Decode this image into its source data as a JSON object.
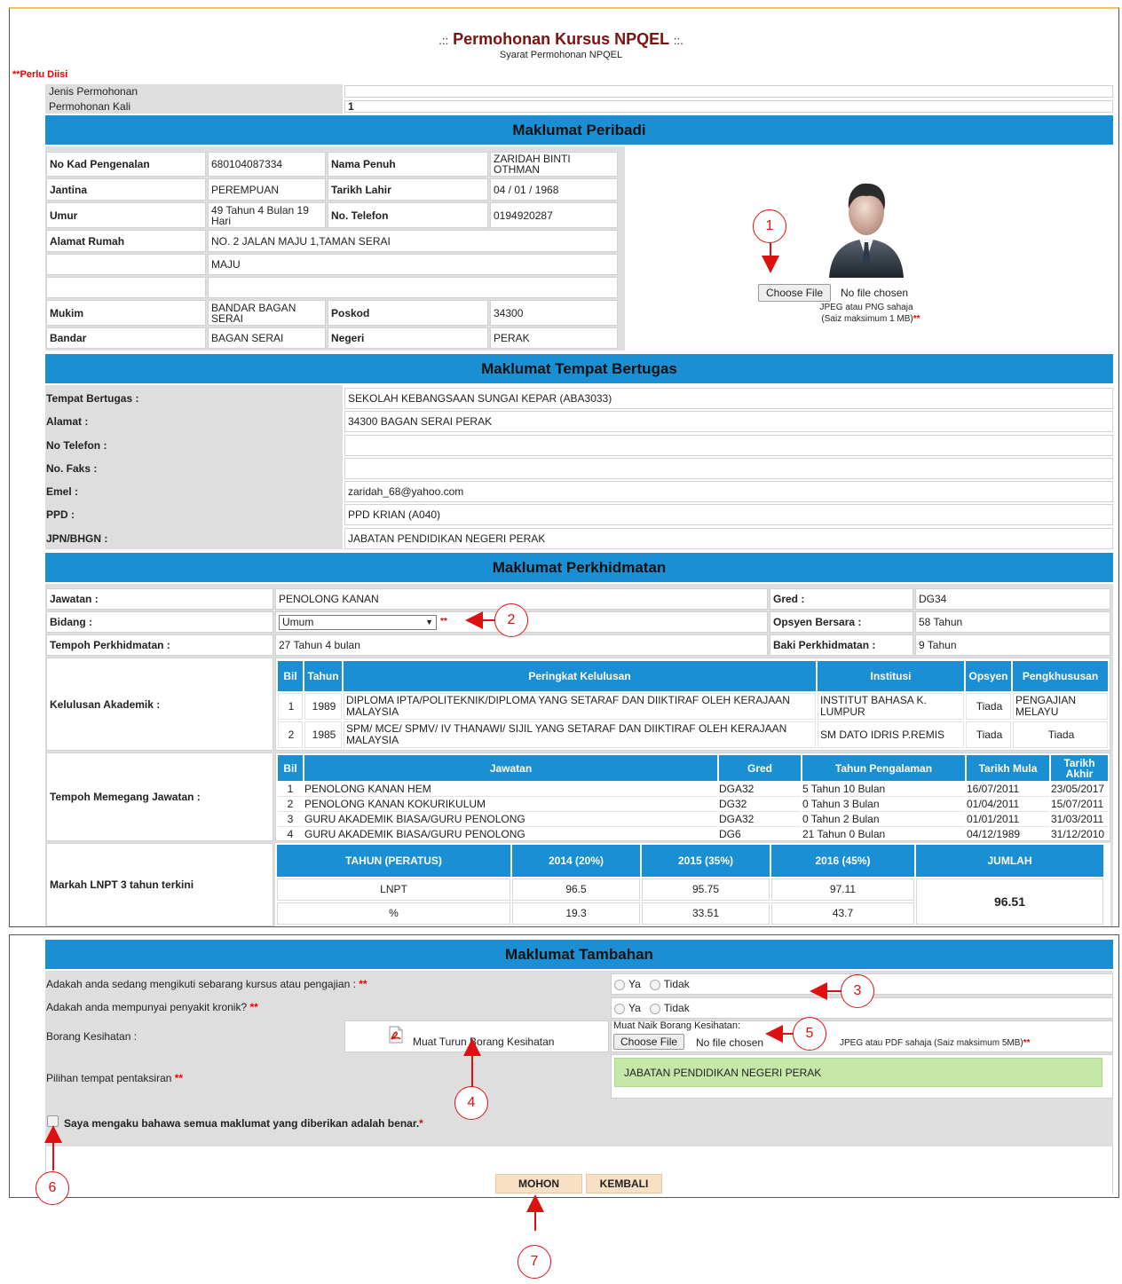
{
  "page": {
    "title": "Permohonan Kursus NPQEL",
    "title_prefix": ".::",
    "title_suffix": "::.",
    "subtitle": "Syarat Permohonan NPQEL",
    "required_note": "**Perlu Diisi"
  },
  "jenis": {
    "label1": "Jenis Permohonan",
    "value1": "",
    "label2": "Permohonan Kali",
    "value2": "1"
  },
  "peribadi": {
    "header": "Maklumat Peribadi",
    "no_kp_label": "No Kad Pengenalan",
    "no_kp": "680104087334",
    "nama_label": "Nama Penuh",
    "nama": "ZARIDAH BINTI OTHMAN",
    "jantina_label": "Jantina",
    "jantina": "PEREMPUAN",
    "tarikh_label": "Tarikh Lahir",
    "tarikh": "04 / 01 / 1968",
    "umur_label": "Umur",
    "umur": "49 Tahun 4 Bulan 19 Hari",
    "telefon_label": "No. Telefon",
    "telefon": "0194920287",
    "alamat_label": "Alamat Rumah",
    "alamat1": "NO. 2 JALAN MAJU 1,TAMAN SERAI",
    "alamat2": "MAJU",
    "alamat3": "",
    "mukim_label": "Mukim",
    "mukim": "BANDAR BAGAN SERAI",
    "poskod_label": "Poskod",
    "poskod": "34300",
    "bandar_label": "Bandar",
    "bandar": "BAGAN SERAI",
    "negeri_label": "Negeri",
    "negeri": "PERAK",
    "photo_button": "Choose File",
    "photo_status": "No file chosen",
    "photo_hint1": "JPEG atau PNG sahaja",
    "photo_hint2": "(Saiz maksimum 1 MB)",
    "photo_req": "**"
  },
  "tempat": {
    "header": "Maklumat Tempat Bertugas",
    "rows": [
      {
        "label": "Tempat Bertugas :",
        "value": "SEKOLAH KEBANGSAAN SUNGAI KEPAR (ABA3033)"
      },
      {
        "label": "Alamat :",
        "value": "34300 BAGAN SERAI PERAK"
      },
      {
        "label": "No Telefon :",
        "value": ""
      },
      {
        "label": "No. Faks :",
        "value": ""
      },
      {
        "label": "Emel :",
        "value": "zaridah_68@yahoo.com"
      },
      {
        "label": "PPD :",
        "value": "PPD KRIAN (A040)"
      },
      {
        "label": "JPN/BHGN :",
        "value": "JABATAN PENDIDIKAN NEGERI PERAK"
      }
    ]
  },
  "perkhidmatan": {
    "header": "Maklumat Perkhidmatan",
    "jawatan_label": "Jawatan :",
    "jawatan": "PENOLONG KANAN",
    "gred_label": "Gred :",
    "gred": "DG34",
    "bidang_label": "Bidang :",
    "bidang": "Umum",
    "bidang_req": "**",
    "opsyen_label": "Opsyen Bersara :",
    "opsyen": "58 Tahun",
    "tempoh_label": "Tempoh Perkhidmatan :",
    "tempoh": "27 Tahun 4 bulan",
    "baki_label": "Baki Perkhidmatan :",
    "baki": "9 Tahun",
    "akademik_label": "Kelulusan Akademik :",
    "akademik_headers": [
      "Bil",
      "Tahun",
      "Peringkat Kelulusan",
      "Institusi",
      "Opsyen",
      "Pengkhususan"
    ],
    "akademik_rows": [
      {
        "bil": "1",
        "tahun": "1989",
        "peringkat": "DIPLOMA IPTA/POLITEKNIK/DIPLOMA YANG SETARAF DAN DIIKTIRAF OLEH KERAJAAN MALAYSIA",
        "institusi": "INSTITUT BAHASA K. LUMPUR",
        "opsyen": "Tiada",
        "pengkhususan": "PENGAJIAN MELAYU"
      },
      {
        "bil": "2",
        "tahun": "1985",
        "peringkat": "SPM/ MCE/ SPMV/ IV THANAWI/ SIJIL YANG SETARAF DAN DIIKTIRAF OLEH KERAJAAN MALAYSIA",
        "institusi": "SM DATO IDRIS P.REMIS",
        "opsyen": "Tiada",
        "pengkhususan": "Tiada"
      }
    ],
    "memegang_label": "Tempoh Memegang Jawatan :",
    "memegang_headers": [
      "Bil",
      "Jawatan",
      "Gred",
      "Tahun Pengalaman",
      "Tarikh Mula",
      "Tarikh Akhir"
    ],
    "memegang_rows": [
      {
        "bil": "1",
        "jawatan": "PENOLONG KANAN HEM",
        "gred": "DGA32",
        "pengalaman": "5 Tahun 10 Bulan",
        "mula": "16/07/2011",
        "akhir": "23/05/2017"
      },
      {
        "bil": "2",
        "jawatan": "PENOLONG KANAN KOKURIKULUM",
        "gred": "DG32",
        "pengalaman": "0 Tahun 3 Bulan",
        "mula": "01/04/2011",
        "akhir": "15/07/2011"
      },
      {
        "bil": "3",
        "jawatan": "GURU AKADEMIK BIASA/GURU PENOLONG",
        "gred": "DGA32",
        "pengalaman": "0 Tahun 2 Bulan",
        "mula": "01/01/2011",
        "akhir": "31/03/2011"
      },
      {
        "bil": "4",
        "jawatan": "GURU AKADEMIK BIASA/GURU PENOLONG",
        "gred": "DG6",
        "pengalaman": "21 Tahun 0 Bulan",
        "mula": "04/12/1989",
        "akhir": "31/12/2010"
      }
    ],
    "lnpt_label": "Markah LNPT 3 tahun terkini",
    "lnpt_headers": [
      "TAHUN (PERATUS)",
      "2014 (20%)",
      "2015 (35%)",
      "2016 (45%)",
      "JUMLAH"
    ],
    "lnpt_row1": [
      "LNPT",
      "96.5",
      "95.75",
      "97.11"
    ],
    "lnpt_row2": [
      "%",
      "19.3",
      "33.51",
      "43.7"
    ],
    "lnpt_jumlah": "96.51"
  },
  "tambahan": {
    "header": "Maklumat Tambahan",
    "q1": "Adakah anda sedang mengikuti sebarang kursus atau pengajian :",
    "q1_req": "**",
    "q2": "Adakah anda mempunyai penyakit kronik?",
    "q2_req": "**",
    "ya": "Ya",
    "tidak": "Tidak",
    "borang_label": "Borang Kesihatan :",
    "muat_turun": "Muat Turun Borang Kesihatan",
    "muat_naik_label": "Muat Naik Borang Kesihatan:",
    "file_button": "Choose File",
    "file_status": "No file chosen",
    "file_hint": "JPEG atau PDF sahaja  (Saiz maksimum 5MB)",
    "file_req": "**",
    "pilihan_label": "Pilihan tempat pentaksiran",
    "pilihan_req": "**",
    "pilihan_value": "JABATAN PENDIDIKAN NEGERI PERAK",
    "akuan": "Saya mengaku bahawa semua maklumat yang diberikan adalah benar.",
    "akuan_req": "*"
  },
  "buttons": {
    "mohon": "MOHON",
    "kembali": "KEMBALI"
  },
  "annotations": [
    "1",
    "2",
    "3",
    "4",
    "5",
    "6",
    "7"
  ],
  "colors": {
    "header_blue": "#1a8fd3",
    "title_maroon": "#7a1212",
    "annotation_red": "#d11",
    "selected_green": "#c5e8a8"
  }
}
